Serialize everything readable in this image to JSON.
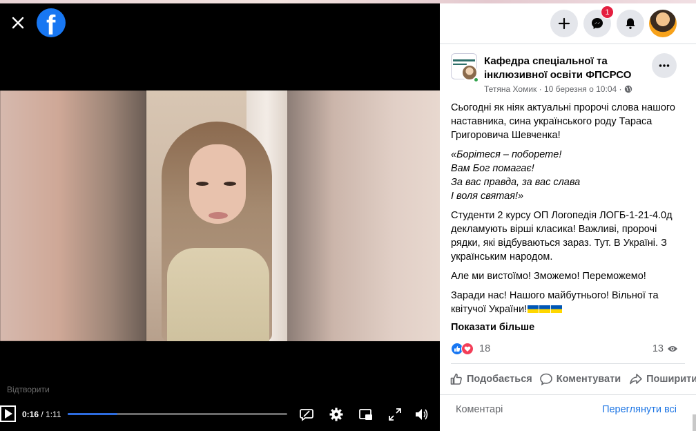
{
  "viewer": {
    "play_label": "Відтворити",
    "time_current": "0:16",
    "time_total": "1:11",
    "progress_fraction": 0.225
  },
  "topbar": {
    "messenger_badge": "1"
  },
  "post": {
    "page_name": "Кафедра спеціальної та інклюзивної освіти ФПСРСО",
    "author": "Тетяна Хомик",
    "separator": " · ",
    "date": "10 березня о 10:04",
    "meta_separator": " · ",
    "paragraph1": "Сьогодні як ніяк актуальні пророчі слова нашого наставника, сина українського роду Тараса Григоровича Шевченка!",
    "quote": {
      "line1": "«Борітеся – поборете!",
      "line2": "Вам Бог помагає!",
      "line3": "За вас правда, за вас слава",
      "line4": "І воля святая!»"
    },
    "paragraph3": "Студенти 2 курсу ОП Логопедія ЛОГБ-1-21-4.0д декламують вірші класика! Важливі, пророчі рядки, які відбуваються зараз. Тут. В Україні. З українським народом.",
    "paragraph4": "Але ми вистоїмо! Зможемо! Переможемо!",
    "paragraph5": "Заради нас! Нашого майбутнього! Вільної та квітучої України!",
    "see_more": "Показати більше",
    "reaction_count": "18",
    "view_count": "13",
    "actions": {
      "like": "Подобається",
      "comment": "Коментувати",
      "share": "Поширити"
    },
    "comments_label": "Коментарі",
    "view_all": "Переглянути всі"
  },
  "colors": {
    "fb_blue": "#1877f2",
    "link_blue": "#1b74e4",
    "badge_red": "#e41e3f",
    "progress_blue": "#2d6cdf"
  }
}
